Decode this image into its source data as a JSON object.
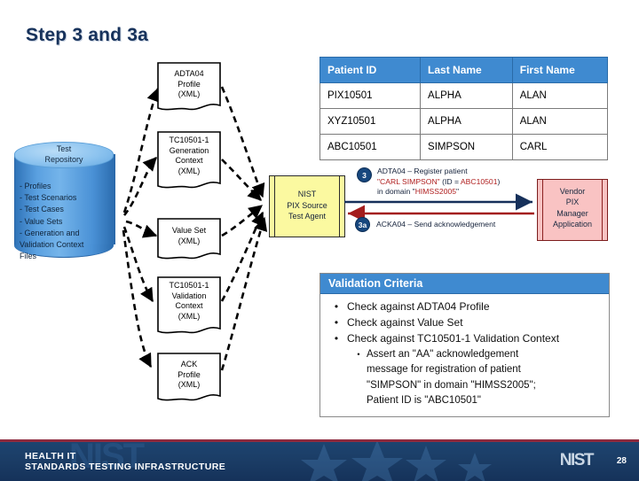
{
  "slide": {
    "title": "Step 3 and 3a",
    "page_number": "28"
  },
  "repository": {
    "name_line1": "Test",
    "name_line2": "Repository",
    "items": [
      "- Profiles",
      "- Test Scenarios",
      "- Test Cases",
      "- Value Sets",
      "- Generation and",
      "  Validation Context",
      "  Files"
    ]
  },
  "documents": [
    {
      "id": "adta04-profile",
      "lines": [
        "ADTA04",
        "Profile",
        "(XML)"
      ]
    },
    {
      "id": "generation-context",
      "lines": [
        "TC10501-1",
        "Generation",
        "Context",
        "(XML)"
      ]
    },
    {
      "id": "value-set",
      "lines": [
        "Value Set",
        "(XML)"
      ]
    },
    {
      "id": "validation-context",
      "lines": [
        "TC10501-1",
        "Validation",
        "Context",
        "(XML)"
      ]
    },
    {
      "id": "ack-profile",
      "lines": [
        "ACK",
        "Profile",
        "(XML)"
      ]
    }
  ],
  "patient_table": {
    "headers": [
      "Patient ID",
      "Last Name",
      "First Name"
    ],
    "rows": [
      [
        "PIX10501",
        "ALPHA",
        "ALAN"
      ],
      [
        "XYZ10501",
        "ALPHA",
        "ALAN"
      ],
      [
        "ABC10501",
        "SIMPSON",
        "CARL"
      ]
    ]
  },
  "test_agent": {
    "line1": "NIST",
    "line2": "PIX Source",
    "line3": "Test Agent"
  },
  "vendor_app": {
    "line1": "Vendor",
    "line2": "PIX",
    "line3": "Manager",
    "line4": "Application"
  },
  "messages": [
    {
      "badge": "3",
      "line1_pre": "ADTA04 – Register patient",
      "line2_a": "\"CARL SIMPSON\"",
      "line2_b": " (ID = ",
      "line2_c": "ABC10501",
      "line2_d": ")",
      "line3_a": "in domain \"",
      "line3_b": "HIMSS2005",
      "line3_c": "\""
    },
    {
      "badge": "3a",
      "text": "ACKA04 – Send acknowledgement"
    }
  ],
  "validation": {
    "header": "Validation Criteria",
    "items": [
      {
        "level": 1,
        "bullet": "•",
        "text": "Check against ADTA04 Profile"
      },
      {
        "level": 1,
        "bullet": "•",
        "text": "Check against Value Set"
      },
      {
        "level": 1,
        "bullet": "•",
        "text": "Check against TC10501-1 Validation Context"
      },
      {
        "level": 2,
        "bullet": "•",
        "text": "Assert an \"AA\" acknowledgement"
      },
      {
        "level": 2,
        "bullet": "",
        "text": "message for registration of patient"
      },
      {
        "level": 2,
        "bullet": "",
        "text": "\"SIMPSON\" in domain \"HIMSS2005\";"
      },
      {
        "level": 2,
        "bullet": "",
        "text": "Patient ID is \"ABC10501\""
      }
    ]
  },
  "footer": {
    "line1": "HEALTH IT",
    "line2": "STANDARDS TESTING INFRASTRUCTURE",
    "logo": "NIST",
    "watermark": "NIST"
  },
  "colors": {
    "title": "#17325B",
    "table_header": "#3f8ad0",
    "agent_fill": "#fbf9a0",
    "vendor_fill": "#f9c3c3",
    "badge": "#17477e",
    "highlight": "#b02020",
    "footer": "#1b3d66",
    "footer_rule": "#8e2b3f"
  }
}
